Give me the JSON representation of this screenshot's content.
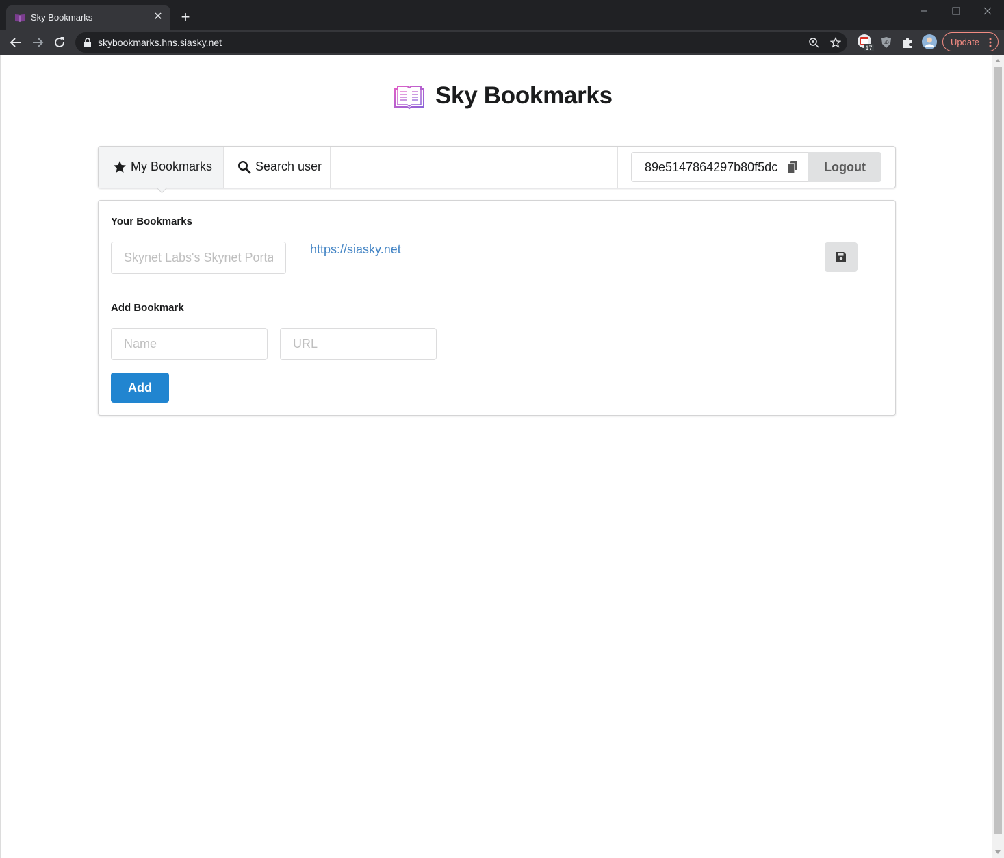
{
  "browser": {
    "tab_title": "Sky Bookmarks",
    "url": "skybookmarks.hns.siasky.net",
    "update_label": "Update",
    "calendar_badge": "17",
    "ublock_label": "uD"
  },
  "app": {
    "title": "Sky Bookmarks"
  },
  "menu": {
    "my_bookmarks": "My Bookmarks",
    "search_user": "Search user",
    "public_key": "89e5147864297b80f5dc",
    "logout": "Logout"
  },
  "bookmarks": {
    "section_title": "Your Bookmarks",
    "items": [
      {
        "name_placeholder": "Skynet Labs's Skynet Portal",
        "url": "https://siasky.net"
      }
    ]
  },
  "add_bookmark": {
    "section_title": "Add Bookmark",
    "name_placeholder": "Name",
    "url_placeholder": "URL",
    "add_label": "Add"
  },
  "colors": {
    "primary": "#2185d0",
    "link": "#4183c4",
    "logo_gradient_start": "#e05fc6",
    "logo_gradient_end": "#8a63d8"
  }
}
